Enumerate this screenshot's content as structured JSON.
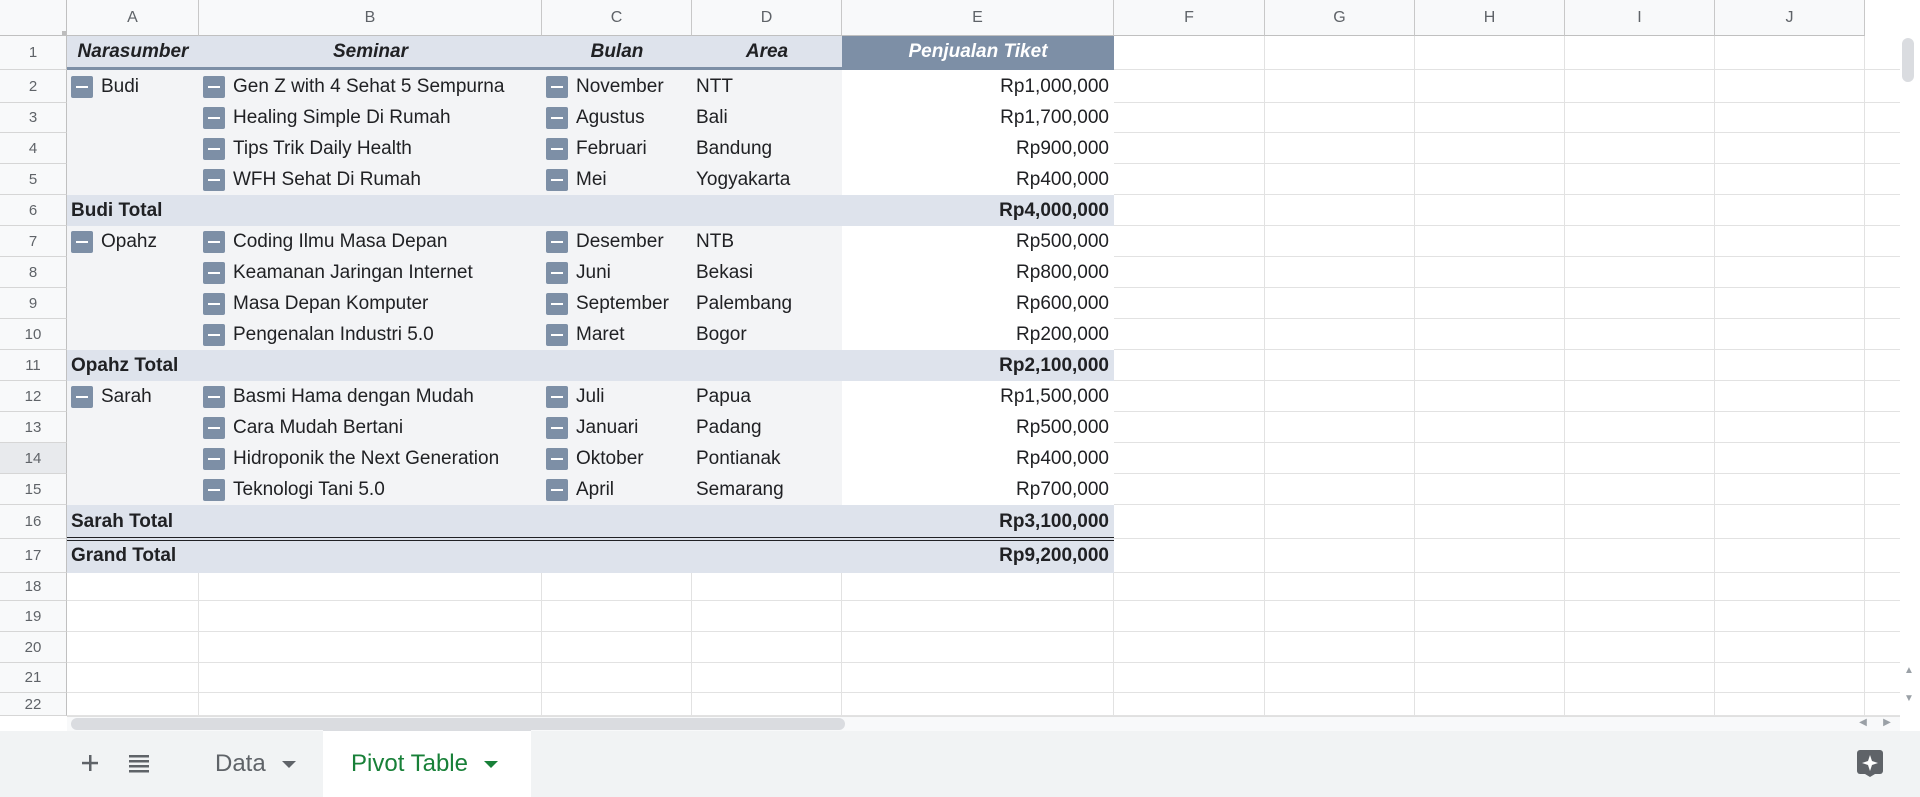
{
  "columns": [
    "A",
    "B",
    "C",
    "D",
    "E",
    "F",
    "G",
    "H",
    "I",
    "J"
  ],
  "rows": [
    "1",
    "2",
    "3",
    "4",
    "5",
    "6",
    "7",
    "8",
    "9",
    "10",
    "11",
    "12",
    "13",
    "14",
    "15",
    "16",
    "17",
    "18",
    "19",
    "20",
    "21",
    "22"
  ],
  "pivot": {
    "headers": {
      "narasumber": "Narasumber",
      "seminar": "Seminar",
      "bulan": "Bulan",
      "area": "Area",
      "penjualan": "Penjualan Tiket"
    },
    "groups": [
      {
        "name": "Budi",
        "total_label": "Budi Total",
        "total": "Rp4,000,000",
        "rows": [
          {
            "seminar": "Gen Z with 4 Sehat 5 Sempurna",
            "bulan": "November",
            "area": "NTT",
            "value": "Rp1,000,000"
          },
          {
            "seminar": "Healing Simple Di Rumah",
            "bulan": "Agustus",
            "area": "Bali",
            "value": "Rp1,700,000"
          },
          {
            "seminar": "Tips Trik Daily Health",
            "bulan": "Februari",
            "area": "Bandung",
            "value": "Rp900,000"
          },
          {
            "seminar": "WFH Sehat Di Rumah",
            "bulan": "Mei",
            "area": "Yogyakarta",
            "value": "Rp400,000"
          }
        ]
      },
      {
        "name": "Opahz",
        "total_label": "Opahz Total",
        "total": "Rp2,100,000",
        "rows": [
          {
            "seminar": "Coding Ilmu Masa Depan",
            "bulan": "Desember",
            "area": "NTB",
            "value": "Rp500,000"
          },
          {
            "seminar": "Keamanan Jaringan Internet",
            "bulan": "Juni",
            "area": "Bekasi",
            "value": "Rp800,000"
          },
          {
            "seminar": "Masa Depan Komputer",
            "bulan": "September",
            "area": "Palembang",
            "value": "Rp600,000"
          },
          {
            "seminar": "Pengenalan Industri 5.0",
            "bulan": "Maret",
            "area": "Bogor",
            "value": "Rp200,000"
          }
        ]
      },
      {
        "name": "Sarah",
        "total_label": "Sarah Total",
        "total": "Rp3,100,000",
        "rows": [
          {
            "seminar": "Basmi Hama dengan Mudah",
            "bulan": "Juli",
            "area": "Papua",
            "value": "Rp1,500,000"
          },
          {
            "seminar": "Cara Mudah Bertani",
            "bulan": "Januari",
            "area": "Padang",
            "value": "Rp500,000"
          },
          {
            "seminar": "Hidroponik the Next Generation",
            "bulan": "Oktober",
            "area": "Pontianak",
            "value": "Rp400,000"
          },
          {
            "seminar": "Teknologi Tani 5.0",
            "bulan": "April",
            "area": "Semarang",
            "value": "Rp700,000"
          }
        ]
      }
    ],
    "grand_total_label": "Grand Total",
    "grand_total": "Rp9,200,000"
  },
  "tabs": [
    {
      "label": "Data",
      "active": false
    },
    {
      "label": "Pivot Table",
      "active": true
    }
  ],
  "icons": {
    "add_sheet": "plus-icon",
    "all_sheets": "list-icon",
    "explore": "explore-sparkle-icon",
    "collapse": "collapse-minus-icon"
  },
  "colors": {
    "header_fill": "#dee3ec",
    "value_header_fill": "#7d8fa6",
    "body_fill": "#f3f4f6",
    "active_tab_text": "#188038"
  }
}
